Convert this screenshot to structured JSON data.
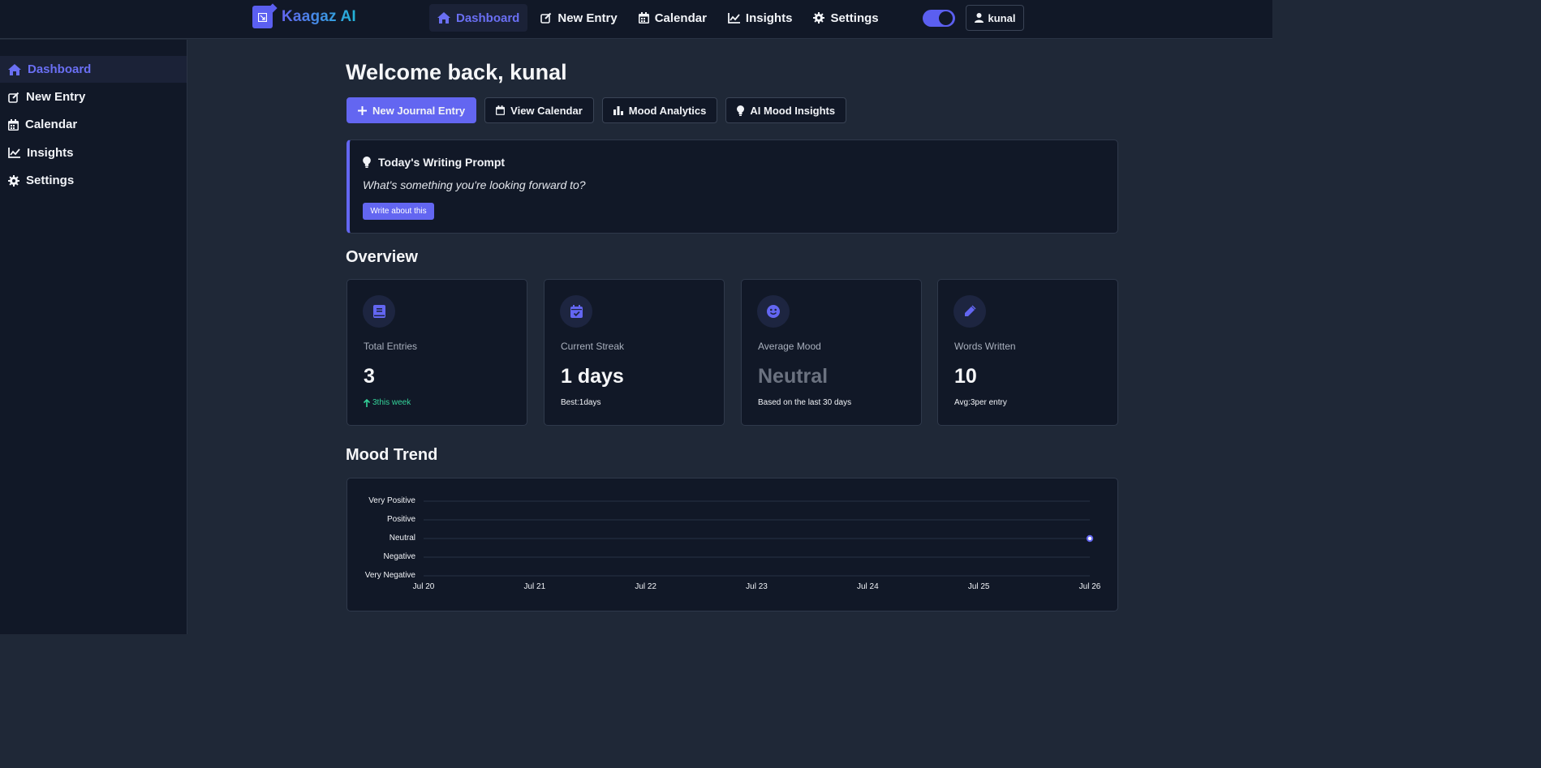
{
  "app": {
    "name": "Kaagaz AI"
  },
  "topnav": {
    "items": [
      {
        "label": "Dashboard",
        "icon": "home-icon",
        "active": true
      },
      {
        "label": "New Entry",
        "icon": "edit-icon"
      },
      {
        "label": "Calendar",
        "icon": "calendar-icon"
      },
      {
        "label": "Insights",
        "icon": "chart-line-icon"
      },
      {
        "label": "Settings",
        "icon": "gear-icon"
      }
    ],
    "theme_toggle_on": true,
    "user": "kunal"
  },
  "sidebar": {
    "items": [
      {
        "label": "Dashboard",
        "icon": "home-icon",
        "active": true
      },
      {
        "label": "New Entry",
        "icon": "edit-icon"
      },
      {
        "label": "Calendar",
        "icon": "calendar-icon"
      },
      {
        "label": "Insights",
        "icon": "chart-line-icon"
      },
      {
        "label": "Settings",
        "icon": "gear-icon"
      }
    ]
  },
  "main": {
    "welcome": "Welcome back, kunal",
    "actions": [
      {
        "label": "New Journal Entry",
        "icon": "plus-icon"
      },
      {
        "label": "View Calendar",
        "icon": "calendar-icon"
      },
      {
        "label": "Mood Analytics",
        "icon": "bar-chart-icon"
      },
      {
        "label": "AI Mood Insights",
        "icon": "lightbulb-icon"
      }
    ],
    "prompt": {
      "title": "Today's Writing Prompt",
      "text": "What's something you're looking forward to?",
      "button": "Write about this"
    },
    "overview_title": "Overview",
    "stats": [
      {
        "label": "Total Entries",
        "value": "3",
        "foot": "3this week",
        "icon": "book-icon"
      },
      {
        "label": "Current Streak",
        "value": "1 days",
        "foot": "Best:1days",
        "icon": "calendar-check-icon"
      },
      {
        "label": "Average Mood",
        "value": "Neutral",
        "foot": "Based on the last 30 days",
        "icon": "smile-icon"
      },
      {
        "label": "Words Written",
        "value": "10",
        "foot": "Avg:3per entry",
        "icon": "pen-icon"
      }
    ],
    "mood_trend_title": "Mood Trend"
  },
  "colors": {
    "accent": "#6366f1",
    "positive": "#34d399",
    "muted": "#6b7280"
  },
  "chart_data": {
    "type": "line",
    "x": [
      "Jul 20",
      "Jul 21",
      "Jul 22",
      "Jul 23",
      "Jul 24",
      "Jul 25",
      "Jul 26"
    ],
    "y_categories": [
      "Very Negative",
      "Negative",
      "Neutral",
      "Positive",
      "Very Positive"
    ],
    "series": [
      {
        "points": [
          {
            "x": "Jul 26",
            "y": "Neutral"
          }
        ]
      }
    ],
    "grid": true,
    "title": "",
    "xlabel": "",
    "ylabel": ""
  }
}
